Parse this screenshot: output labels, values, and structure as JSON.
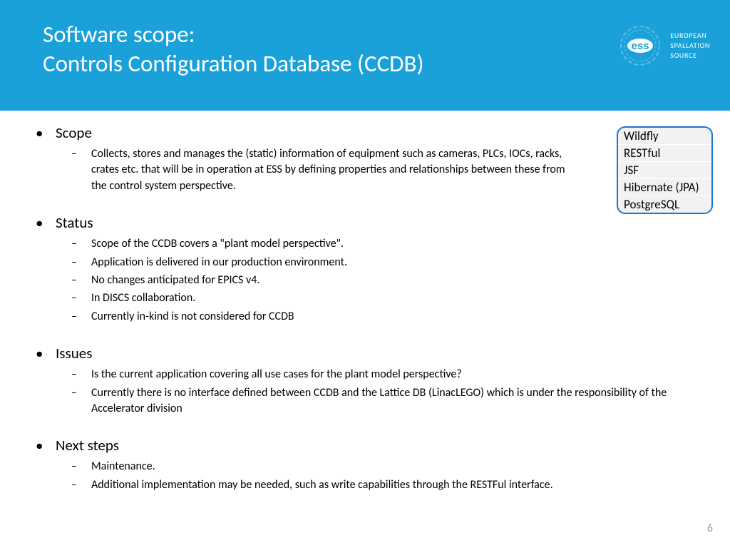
{
  "header": {
    "title_line1": "Software scope:",
    "title_line2": "Controls Configuration Database (CCDB)",
    "org_line1": "EUROPEAN",
    "org_line2": "SPALLATION",
    "org_line3": "SOURCE",
    "logo_abbr": "ess"
  },
  "tech_stack": {
    "items": [
      "Wildfly",
      "RESTful",
      "JSF",
      "Hibernate (JPA)",
      "PostgreSQL"
    ]
  },
  "sections": {
    "scope": {
      "heading": "Scope",
      "items": [
        "Collects, stores and manages the (static) information of equipment such as cameras, PLCs, IOCs, racks, crates etc. that will be in operation at ESS by defining properties and relationships between these from the control system perspective."
      ]
    },
    "status": {
      "heading": "Status",
      "items": [
        "Scope of the CCDB covers a \"plant model perspective\".",
        "Application is delivered in our production environment.",
        "No changes anticipated for EPICS v4.",
        "In DISCS collaboration.",
        "Currently in-kind is not considered for CCDB"
      ]
    },
    "issues": {
      "heading": "Issues",
      "items": [
        "Is the current application covering all use cases for the plant model perspective?",
        "Currently there is no interface defined between CCDB and the Lattice DB (LinacLEGO) which is under the responsibility of the Accelerator division"
      ]
    },
    "next_steps": {
      "heading": "Next steps",
      "items": [
        "Maintenance.",
        "Additional implementation may be needed, such as write capabilities through the RESTFul interface."
      ]
    }
  },
  "page_number": "6"
}
